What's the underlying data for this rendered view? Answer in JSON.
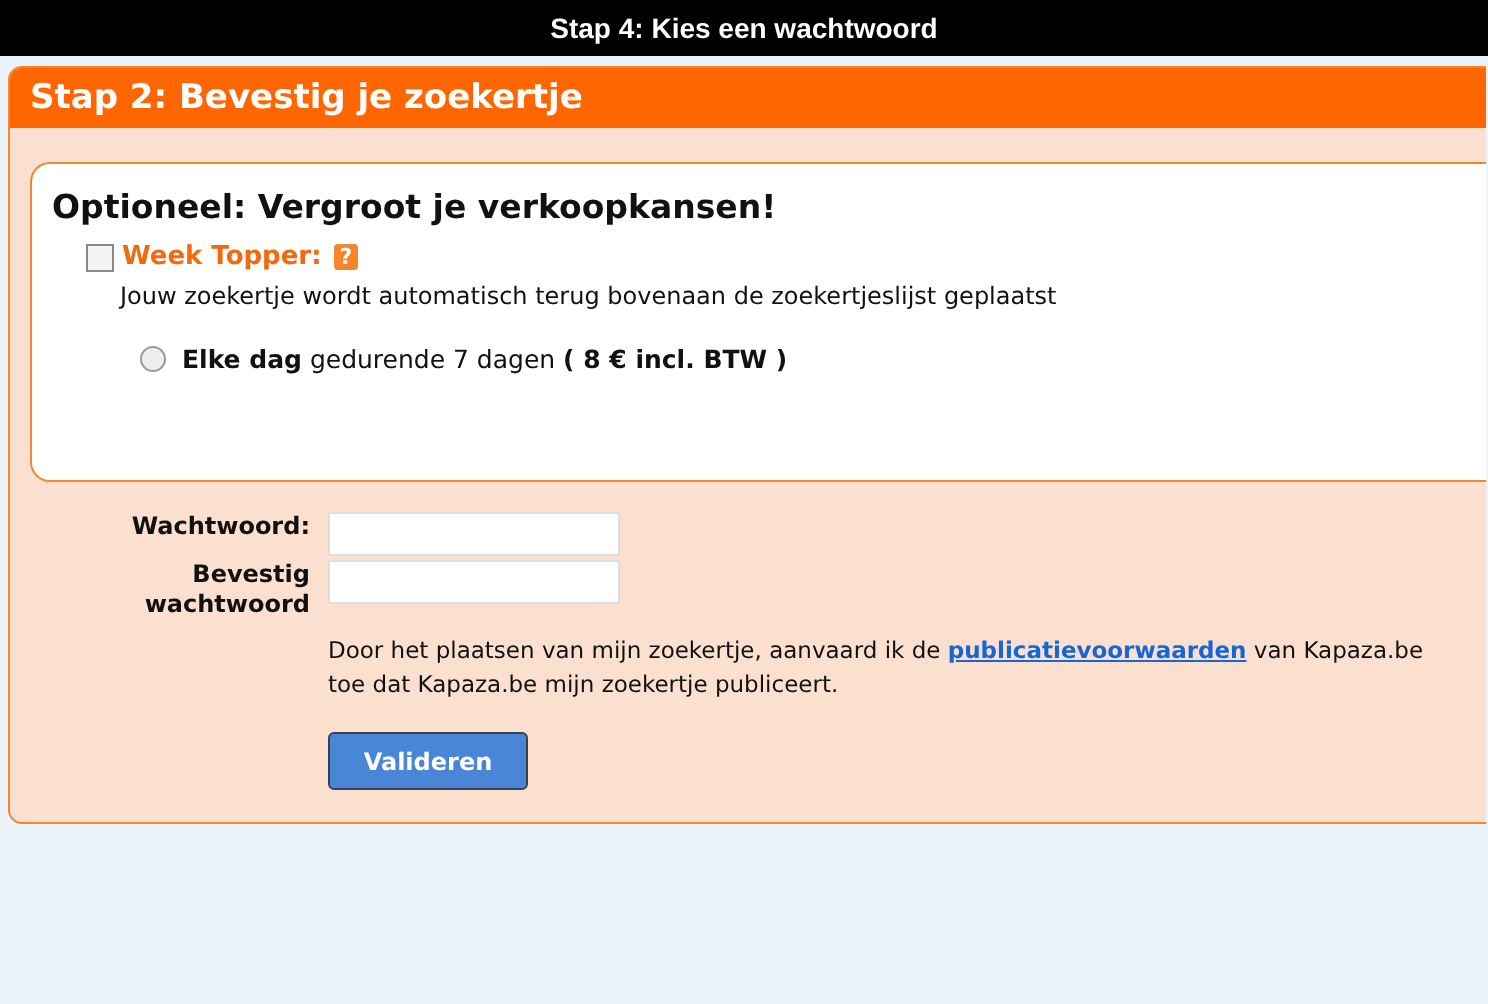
{
  "top_bar": {
    "title": "Stap 4: Kies een wachtwoord"
  },
  "panel": {
    "title": "Stap 2: Bevestig je zoekertje"
  },
  "options": {
    "heading": "Optioneel: Vergroot je verkoopkansen!",
    "week_topper": {
      "label": "Week Topper:",
      "help": "?",
      "checked": false,
      "description": "Jouw zoekertje wordt automatisch terug bovenaan de zoekertjeslijst geplaatst"
    },
    "choices": [
      {
        "text": "**Elke dag** gedurende 7 dagen **( 8 € incl. BTW )**",
        "selected": false
      }
    ]
  },
  "form": {
    "fields": [
      {
        "label": "Wachtwoord:"
      },
      {
        "label": "Bevestig wachtwoord"
      }
    ],
    "terms": {
      "before": "Door het plaatsen van mijn zoekertje, aanvaard ik de ",
      "link": "publicatievoorwaarden",
      "after": " van Kapaza.be",
      "line2": "toe dat Kapaza.be mijn zoekertje publiceert."
    },
    "submit": "Valideren"
  }
}
